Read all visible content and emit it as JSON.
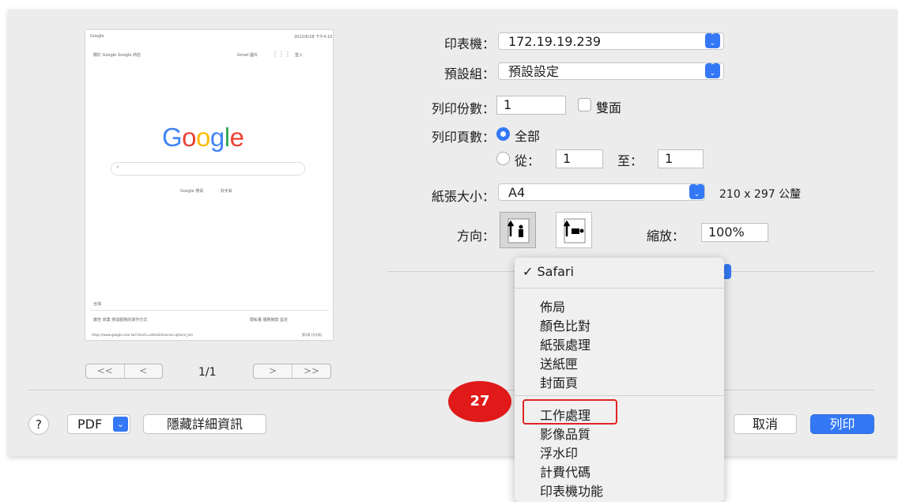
{
  "preview": {
    "header_left": "Google",
    "header_right": "2022/6/28 下午4:10",
    "nav_left": "關於 Google   Google 商店",
    "nav_right": "Gmail   圖片",
    "signin": "登入",
    "logo": [
      {
        "char": "G",
        "color": "#4285f4"
      },
      {
        "char": "o",
        "color": "#ea4335"
      },
      {
        "char": "o",
        "color": "#fbbc05"
      },
      {
        "char": "g",
        "color": "#4285f4"
      },
      {
        "char": "l",
        "color": "#34a853"
      },
      {
        "char": "e",
        "color": "#ea4335"
      }
    ],
    "search_button": "Google 搜尋",
    "lucky_button": "好手氣",
    "region": "台灣",
    "footer_left": "廣告    商業    搜尋服務的運作方式",
    "footer_right": "隱私權    服務條款    設定",
    "url": "https://www.google.com.tw/?client=safari&channel=iphone_bm",
    "page_label": "第1頁 (共1頁)",
    "page_counter": "1/1",
    "pager_first": "<<",
    "pager_prev": "<",
    "pager_next": ">",
    "pager_last": ">>"
  },
  "form": {
    "printer_label": "印表機：",
    "printer_value": "172.19.19.239",
    "preset_label": "預設組：",
    "preset_value": "預設設定",
    "copies_label": "列印份數：",
    "copies_value": "1",
    "duplex_label": "雙面",
    "pages_label": "列印頁數：",
    "pages_all": "全部",
    "pages_from_label": "從：",
    "pages_from_value": "1",
    "pages_to_label": "至：",
    "pages_to_value": "1",
    "paper_label": "紙張大小：",
    "paper_value": "A4",
    "paper_dims": "210 x 297 公釐",
    "orientation_label": "方向：",
    "scale_label": "縮放：",
    "scale_value": "100%"
  },
  "menu": {
    "selected": "✓ Safari",
    "group1": [
      "佈局",
      "顏色比對",
      "紙張處理",
      "送紙匣",
      "封面頁"
    ],
    "group2": [
      "工作處理",
      "影像品質",
      "浮水印",
      "計費代碼",
      "印表機功能"
    ]
  },
  "annotation": {
    "step": "27",
    "color": "#e01919"
  },
  "buttons": {
    "help": "?",
    "pdf": "PDF",
    "hide_details": "隱藏詳細資訊",
    "cancel": "取消",
    "print": "列印"
  },
  "colors": {
    "accent": "#3478f6",
    "highlight": "#e02424"
  }
}
